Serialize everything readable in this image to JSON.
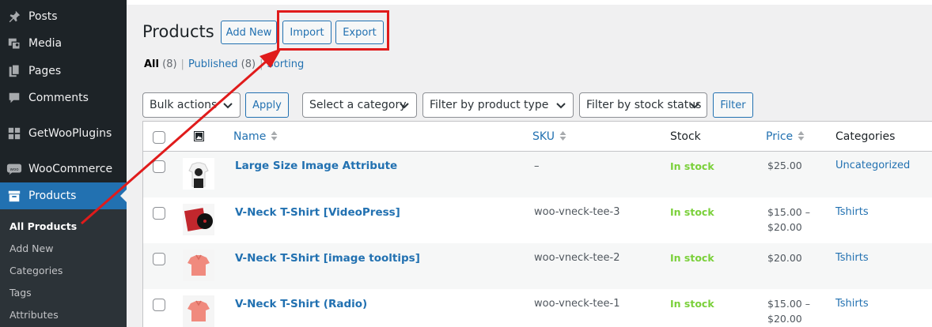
{
  "colors": {
    "sidebar": "#1d2327",
    "submenu": "#2c3338",
    "accent": "#2271b1",
    "in_stock": "#7ad03a",
    "highlight": "#e01b1b"
  },
  "sidebar": {
    "items": [
      {
        "label": "Posts",
        "icon": "pin-icon"
      },
      {
        "label": "Media",
        "icon": "media-icon"
      },
      {
        "label": "Pages",
        "icon": "pages-icon"
      },
      {
        "label": "Comments",
        "icon": "comment-icon"
      },
      {
        "label": "GetWooPlugins",
        "icon": "plugins-icon"
      },
      {
        "label": "WooCommerce",
        "icon": "woocommerce-icon"
      },
      {
        "label": "Products",
        "icon": "archive-icon"
      }
    ],
    "submenu": [
      "All Products",
      "Add New",
      "Categories",
      "Tags",
      "Attributes"
    ]
  },
  "header": {
    "title": "Products",
    "add_new": "Add New",
    "import": "Import",
    "export": "Export"
  },
  "views": {
    "all": "All",
    "all_count": "(8)",
    "published": "Published",
    "published_count": "(8)",
    "sorting": "Sorting"
  },
  "filters": {
    "bulk_actions": "Bulk actions",
    "apply": "Apply",
    "category": "Select a category",
    "product_type": "Filter by product type",
    "stock_status": "Filter by stock status",
    "filter": "Filter"
  },
  "table": {
    "columns": {
      "name": "Name",
      "sku": "SKU",
      "stock": "Stock",
      "price": "Price",
      "categories": "Categories"
    },
    "rows": [
      {
        "name": "Large Size Image Attribute",
        "sku": "–",
        "stock": "In stock",
        "price": "$25.00",
        "price2": "",
        "category": "Uncategorized",
        "thumb": "bw-tshirt"
      },
      {
        "name": "V-Neck T-Shirt [VideoPress]",
        "sku": "woo-vneck-tee-3",
        "stock": "In stock",
        "price": "$15.00 –",
        "price2": "$20.00",
        "category": "Tshirts",
        "thumb": "vinyl"
      },
      {
        "name": "V-Neck T-Shirt [image tooltips]",
        "sku": "woo-vneck-tee-2",
        "stock": "In stock",
        "price": "$20.00",
        "price2": "",
        "category": "Tshirts",
        "thumb": "pink-tshirt"
      },
      {
        "name": "V-Neck T-Shirt (Radio)",
        "sku": "woo-vneck-tee-1",
        "stock": "In stock",
        "price": "$15.00 –",
        "price2": "$20.00",
        "category": "Tshirts",
        "thumb": "pink-tshirt"
      }
    ]
  }
}
